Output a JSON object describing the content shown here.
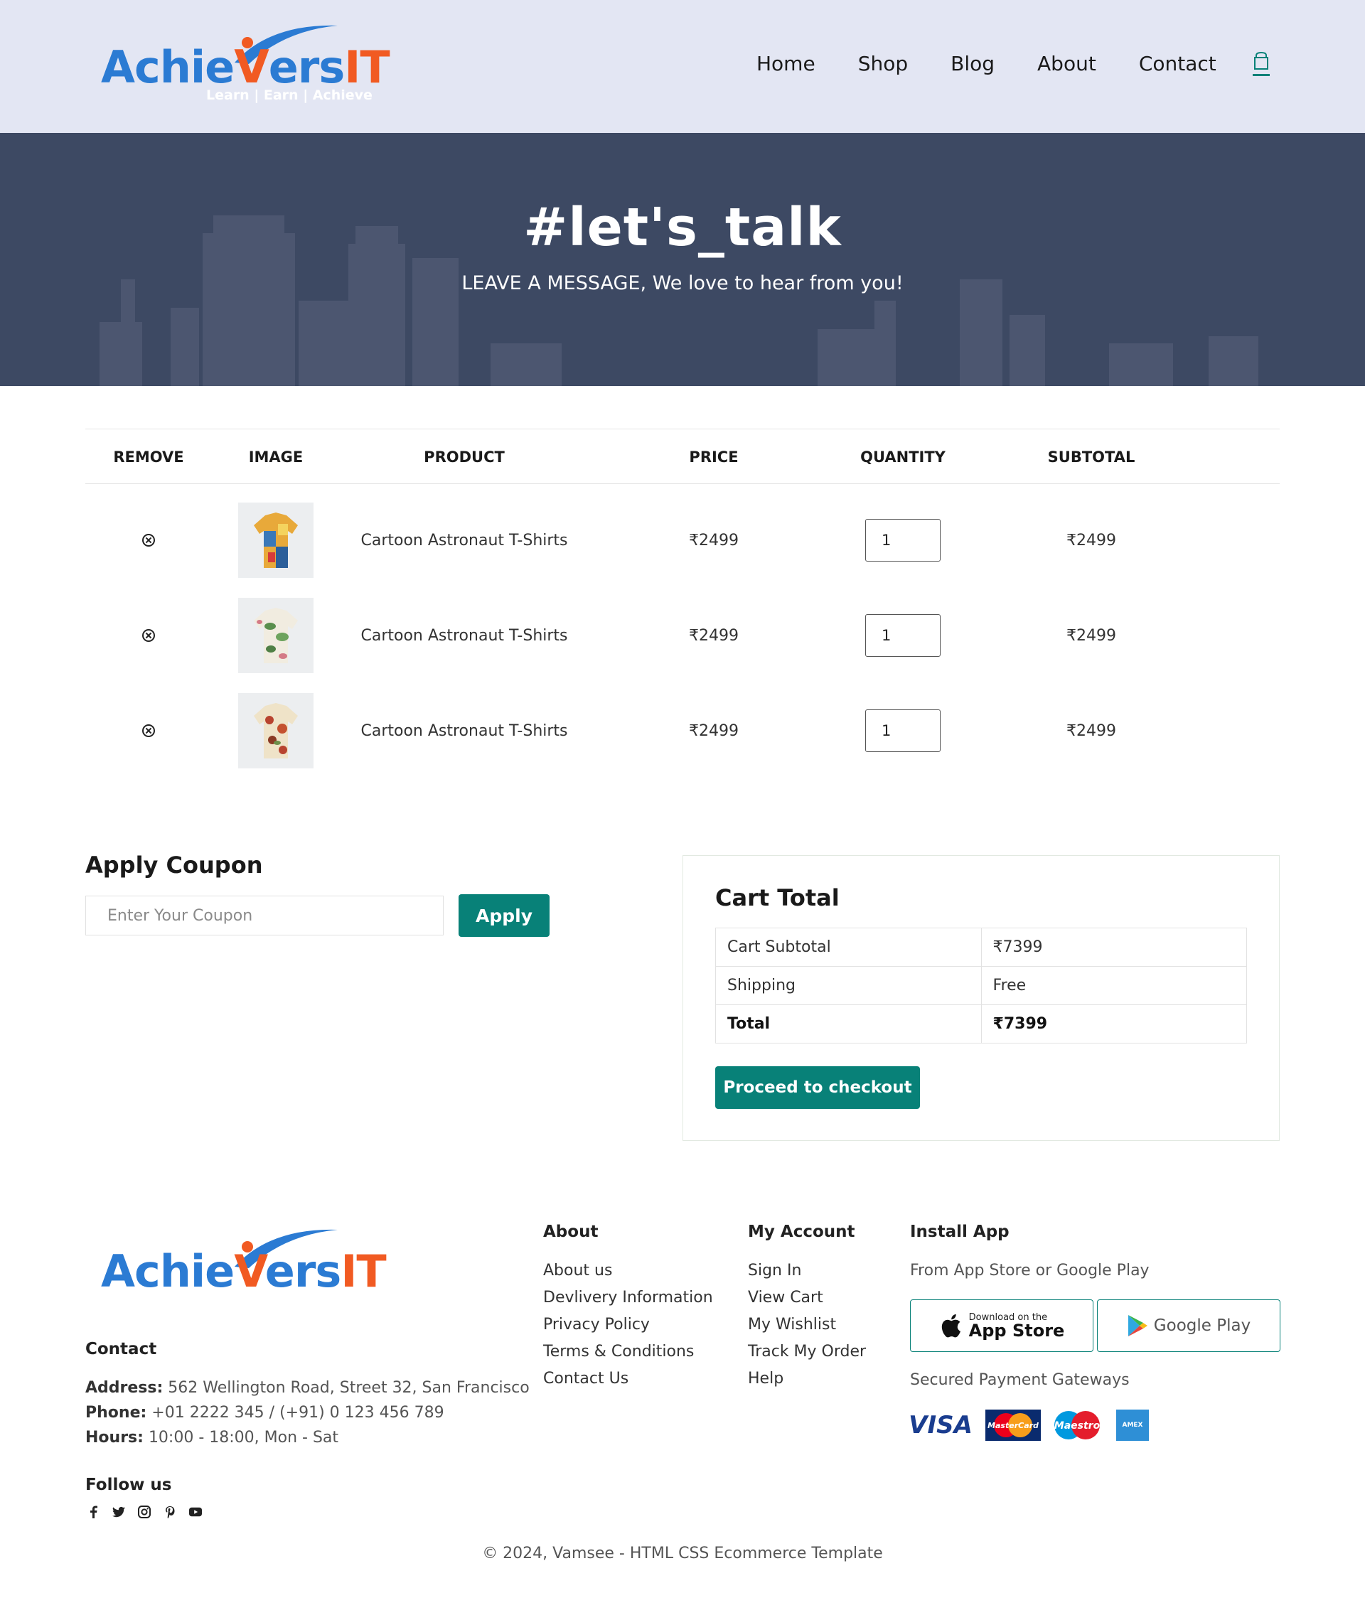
{
  "brand": {
    "name_part1": "Achie",
    "name_part2": "ers",
    "name_part3": "IT",
    "tagline": "Learn | Earn | Achieve"
  },
  "nav": {
    "items": [
      "Home",
      "Shop",
      "Blog",
      "About",
      "Contact"
    ],
    "cart_icon": "shopping-bag-icon"
  },
  "hero": {
    "title": "#let's_talk",
    "subtitle": "LEAVE A MESSAGE, We love to hear from you!"
  },
  "cart_table": {
    "headers": [
      "REMOVE",
      "IMAGE",
      "PRODUCT",
      "PRICE",
      "QUANTITY",
      "SUBTOTAL"
    ],
    "rows": [
      {
        "product": "Cartoon Astronaut T-Shirts",
        "price": "₹2499",
        "quantity": "1",
        "subtotal": "₹2499"
      },
      {
        "product": "Cartoon Astronaut T-Shirts",
        "price": "₹2499",
        "quantity": "1",
        "subtotal": "₹2499"
      },
      {
        "product": "Cartoon Astronaut T-Shirts",
        "price": "₹2499",
        "quantity": "1",
        "subtotal": "₹2499"
      }
    ]
  },
  "coupon": {
    "title": "Apply Coupon",
    "placeholder": "Enter Your Coupon",
    "button": "Apply"
  },
  "cart_total": {
    "title": "Cart Total",
    "subtotal_label": "Cart Subtotal",
    "subtotal_value": "₹7399",
    "shipping_label": "Shipping",
    "shipping_value": "Free",
    "total_label": "Total",
    "total_value": "₹7399",
    "checkout_button": "Proceed to checkout"
  },
  "footer": {
    "contact_title": "Contact",
    "address_label": "Address:",
    "address": "562 Wellington Road, Street 32, San Francisco",
    "phone_label": "Phone:",
    "phone": "+01 2222 345 / (+91) 0 123 456 789",
    "hours_label": "Hours:",
    "hours": "10:00 - 18:00, Mon - Sat",
    "follow_title": "Follow us",
    "about_title": "About",
    "about_links": [
      "About us",
      "Devlivery Information",
      "Privacy Policy",
      "Terms & Conditions",
      "Contact Us"
    ],
    "account_title": "My Account",
    "account_links": [
      "Sign In",
      "View Cart",
      "My Wishlist",
      "Track My Order",
      "Help"
    ],
    "app_title": "Install App",
    "app_subtitle": "From App Store or Google Play",
    "app_store_small": "Download on the",
    "app_store_big": "App Store",
    "google_play": "Google Play",
    "payment_title": "Secured Payment Gateways",
    "payments": [
      "VISA",
      "MasterCard",
      "Maestro",
      "AMEX"
    ],
    "copyright": "© 2024, Vamsee - HTML CSS Ecommerce Template"
  },
  "colors": {
    "accent": "#088178",
    "header_bg": "#e3e6f3",
    "hero_bg": "#3d4963",
    "brand_blue": "#2b7bd3",
    "brand_orange": "#f15a22"
  }
}
